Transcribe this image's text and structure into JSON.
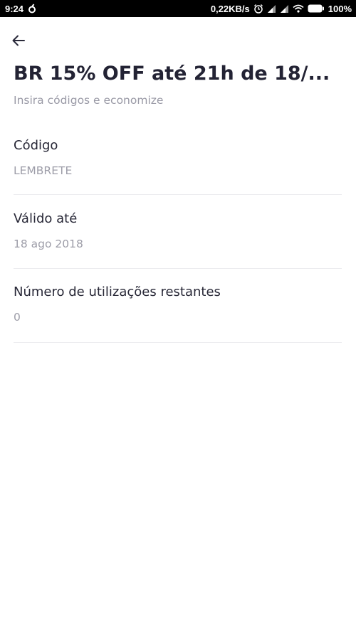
{
  "status_bar": {
    "time": "9:24",
    "network_speed": "0,22KB/s",
    "battery": "100%",
    "icons": [
      "app-notification-icon",
      "alarm-icon",
      "signal-icon",
      "signal-icon",
      "wifi-icon",
      "battery-icon"
    ]
  },
  "header": {
    "back_icon": "arrow-left-icon",
    "title": "BR 15% OFF até 21h de 18/...",
    "subtitle": "Insira códigos e economize"
  },
  "details": [
    {
      "label": "Código",
      "value": "LEMBRETE"
    },
    {
      "label": "Válido até",
      "value": "18 ago 2018"
    },
    {
      "label": "Número de utilizações restantes",
      "value": "0"
    }
  ],
  "colors": {
    "title": "#232334",
    "label": "#272736",
    "secondary": "#9d9da8",
    "divider": "#ececef",
    "status_bar": "#000000"
  }
}
